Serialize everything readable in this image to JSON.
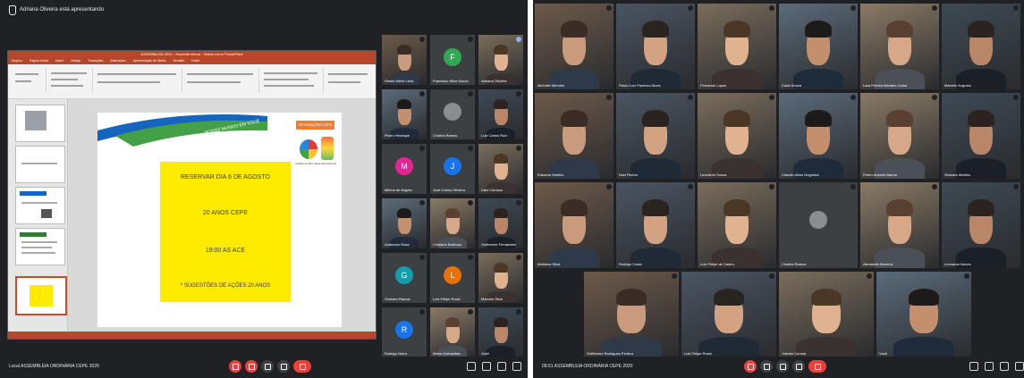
{
  "left_window": {
    "presenting_label": "Adriana Oliveira está apresentando",
    "meeting_title": "Local   ASSEMBLEIA ORDINÁRIA CEPE 2020",
    "ppt": {
      "window_title": "ASSEMBLEIA 2020 - Somente leitura - Salvar como PowerPoint",
      "tabs": [
        "Arquivo",
        "Página Inicial",
        "Inserir",
        "Design",
        "Transições",
        "Animações",
        "Apresentação de Slides",
        "Revisão",
        "Exibir"
      ]
    },
    "slide": {
      "banner_text": "NOSSO MUNDO EM VOCÊ",
      "badge": "INFORMAÇÕES CEPE",
      "logo_caption": "Cidade de Bem-Estar Educacional",
      "lines": [
        "RESERVAR DIA 6 DE AGOSTO",
        "20 ANOS CEPE",
        "19:00 AS ACE",
        "* SUGESTÕES DE AÇÕES 20 ANOS"
      ]
    },
    "participants": [
      {
        "name": "Gisele Meire Lima",
        "type": "video"
      },
      {
        "name": "Francisco Silva Souza",
        "type": "avatar",
        "initial": "F",
        "color": "#33a853"
      },
      {
        "name": "Adriana Oliveira",
        "type": "video",
        "selected": true
      },
      {
        "name": "Pedro Henrique",
        "type": "video"
      },
      {
        "name": "Cristina Ramos",
        "type": "avatar",
        "initial": "",
        "color": "#8a8d91"
      },
      {
        "name": "Luiz Carlos Ruiz",
        "type": "video"
      },
      {
        "name": "Milena de Angelo",
        "type": "avatar",
        "initial": "M",
        "color": "#e52592"
      },
      {
        "name": "José Carlos Oliveira",
        "type": "avatar",
        "initial": "J",
        "color": "#1a73e8"
      },
      {
        "name": "Davi Cardoso",
        "type": "video"
      },
      {
        "name": "Anderson Rosa",
        "type": "video"
      },
      {
        "name": "Cristiano Barbosa",
        "type": "video"
      },
      {
        "name": "Guilherme Fernandes",
        "type": "video"
      },
      {
        "name": "Gustavo Ramos",
        "type": "avatar",
        "initial": "G",
        "color": "#129eaf"
      },
      {
        "name": "Luiz Felipe Rossi",
        "type": "avatar",
        "initial": "L",
        "color": "#e8710a"
      },
      {
        "name": "Marcelo Silva",
        "type": "video"
      },
      {
        "name": "Rodrigo Dutra",
        "type": "avatar",
        "initial": "R",
        "color": "#1a73e8"
      },
      {
        "name": "Mário Guimarães",
        "type": "video"
      },
      {
        "name": "Você",
        "type": "video"
      }
    ]
  },
  "right_window": {
    "meeting_title": "09:51   ASSEMBLEIA ORDINÁRIA CEPE 2020",
    "participants": [
      {
        "name": "Michelle Mendes",
        "type": "video"
      },
      {
        "name": "Flavio Luiz Pacheco Alves",
        "type": "video"
      },
      {
        "name": "Fernando Lopes",
        "type": "video"
      },
      {
        "name": "Carla Souza",
        "type": "video"
      },
      {
        "name": "Lara Pereira Mendes Junior",
        "type": "video"
      },
      {
        "name": "Marcelo Augusto",
        "type": "video"
      },
      {
        "name": "Eduardo Martins",
        "type": "video"
      },
      {
        "name": "Davi Rocha",
        "type": "video"
      },
      {
        "name": "Leonardo Souza",
        "type": "video"
      },
      {
        "name": "Claudio Alves Nogueira",
        "type": "video"
      },
      {
        "name": "Pedro Antonio Barros",
        "type": "video"
      },
      {
        "name": "Gustavo Martins",
        "type": "video"
      },
      {
        "name": "Matheus Silva",
        "type": "video"
      },
      {
        "name": "Rodrigo Costa",
        "type": "video"
      },
      {
        "name": "Luiz Felipe de Castro",
        "type": "video"
      },
      {
        "name": "Cristina Ramos",
        "type": "avatar",
        "initial": "",
        "color": "#8a8d91"
      },
      {
        "name": "Alexandre Bezerra",
        "type": "video"
      },
      {
        "name": "Leonardo Nunes",
        "type": "video"
      },
      {
        "name": "Guilherme Rodrigues Pereira",
        "type": "video"
      },
      {
        "name": "Luiz Felipe Rossi",
        "type": "video"
      },
      {
        "name": "Yasmin Correia",
        "type": "video"
      },
      {
        "name": "Você",
        "type": "video"
      }
    ]
  },
  "colors": {
    "meet_bg": "#202124",
    "tile_bg": "#3c4043",
    "end_call": "#ea4335",
    "ppt_accent": "#b7472a",
    "slide_yellow": "#ffeb00"
  }
}
